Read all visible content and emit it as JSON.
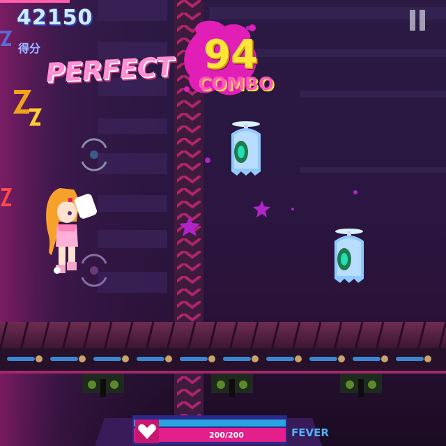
{
  "hud": {
    "score": "42150",
    "score_label": "得分",
    "judgement": "PERFECT",
    "combo_count": "94",
    "combo_label": "COMBO",
    "hp_text": "200/200",
    "hp_fraction": 1.0,
    "fever_label": "FEVER"
  },
  "icons": {
    "pause": "pause-icon",
    "heart": "heart-icon",
    "sleep": "zzz-icon"
  },
  "colors": {
    "score": "#cfe9ff",
    "judgement": "#ff8fd4",
    "combo_number": "#ffe53a",
    "combo_label": "#ff56c0",
    "fever": "#4fb2ff"
  }
}
